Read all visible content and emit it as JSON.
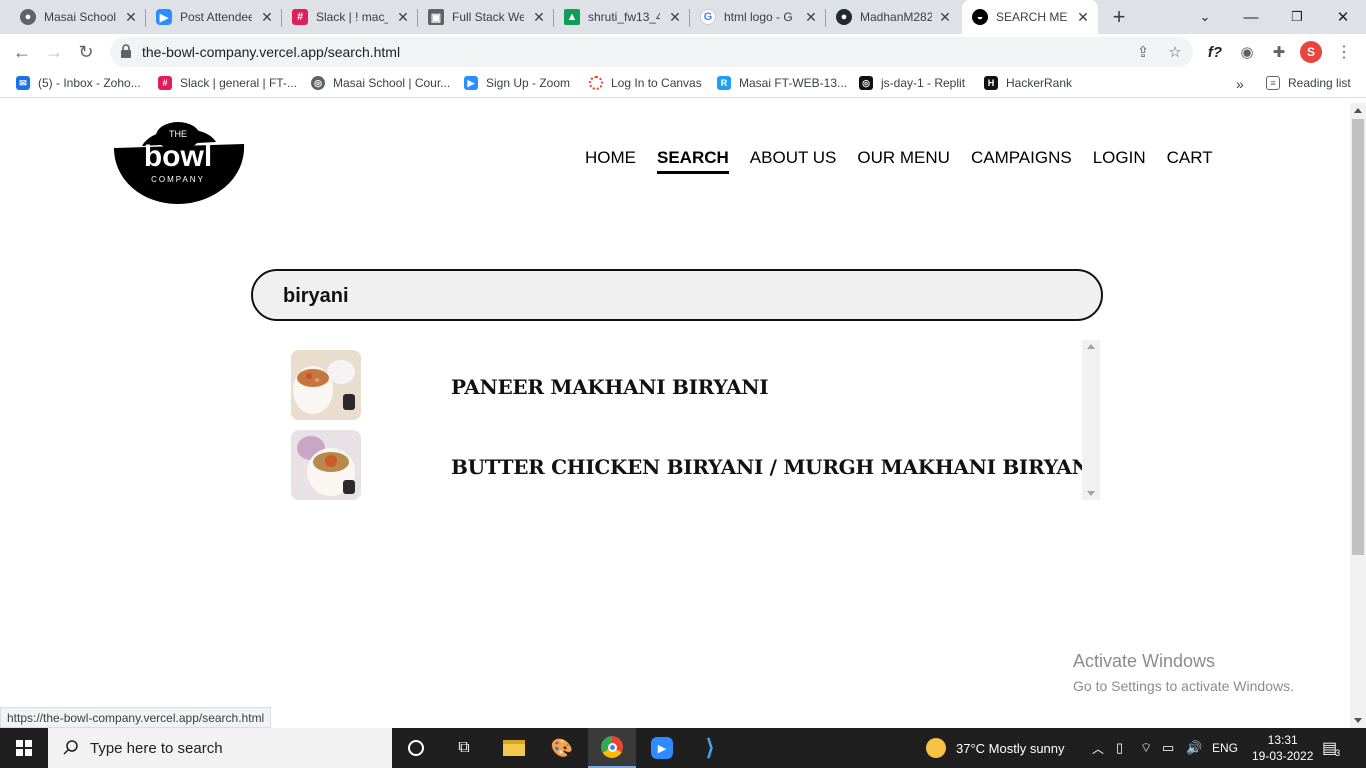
{
  "browser": {
    "tabs": [
      {
        "title": "Masai School",
        "icon": "masai-icon",
        "color": "#5f6368"
      },
      {
        "title": "Post Attendee",
        "icon": "zoom-icon",
        "color": "#2d8cff"
      },
      {
        "title": "Slack | ! mac_",
        "icon": "slack-icon",
        "color": "#e01e5a"
      },
      {
        "title": "Full Stack Web",
        "icon": "course-icon",
        "color": "#5f6368"
      },
      {
        "title": "shruti_fw13_4",
        "icon": "drive-icon",
        "color": "#0f9d58"
      },
      {
        "title": "html logo - G",
        "icon": "google-icon",
        "color": "#4285f4"
      },
      {
        "title": "MadhanM282",
        "icon": "github-icon",
        "color": "#24292e"
      },
      {
        "title": "SEARCH MENU",
        "icon": "bowl-icon",
        "color": "#000000"
      }
    ],
    "new_tab": "+",
    "url": "the-bowl-company.vercel.app/search.html",
    "profile_initial": "S",
    "bookmarks": [
      {
        "label": "(5) - Inbox - Zoho...",
        "icon": "zoho-icon",
        "color": "#1a73e8"
      },
      {
        "label": "Slack | general | FT-...",
        "icon": "slack-icon",
        "color": "#e01e5a"
      },
      {
        "label": "Masai School | Cour...",
        "icon": "globe-icon",
        "color": "#5f6368"
      },
      {
        "label": "Sign Up - Zoom",
        "icon": "zoom-icon",
        "color": "#2d8cff"
      },
      {
        "label": "Log In to Canvas",
        "icon": "canvas-icon",
        "color": "#e4462c"
      },
      {
        "label": "Masai FT-WEB-13...",
        "icon": "replit-icon",
        "color": "#1ea0f2"
      },
      {
        "label": "js-day-1 - Replit",
        "icon": "replit-icon",
        "color": "#111111"
      },
      {
        "label": "HackerRank",
        "icon": "hackerrank-icon",
        "color": "#111111"
      }
    ],
    "more_bookmarks": "»",
    "reading_list": "Reading list",
    "status_url": "https://the-bowl-company.vercel.app/search.html"
  },
  "site": {
    "logo": {
      "top": "THE",
      "middle": "bowl",
      "bottom": "COMPANY"
    },
    "nav": [
      "HOME",
      "SEARCH",
      "ABOUT US",
      "OUR MENU",
      "CAMPAIGNS",
      "LOGIN",
      "CART"
    ],
    "active_nav": "SEARCH",
    "search_value": "biryani",
    "results": [
      {
        "name": "PANEER MAKHANI BIRYANI"
      },
      {
        "name": "BUTTER CHICKEN BIRYANI / MURGH MAKHANI BIRYANI"
      }
    ]
  },
  "watermark": {
    "line1": "Activate Windows",
    "line2": "Go to Settings to activate Windows."
  },
  "taskbar": {
    "search_placeholder": "Type here to search",
    "weather": "37°C  Mostly sunny",
    "language": "ENG",
    "time": "13:31",
    "date": "19-03-2022",
    "notifications": "3"
  }
}
